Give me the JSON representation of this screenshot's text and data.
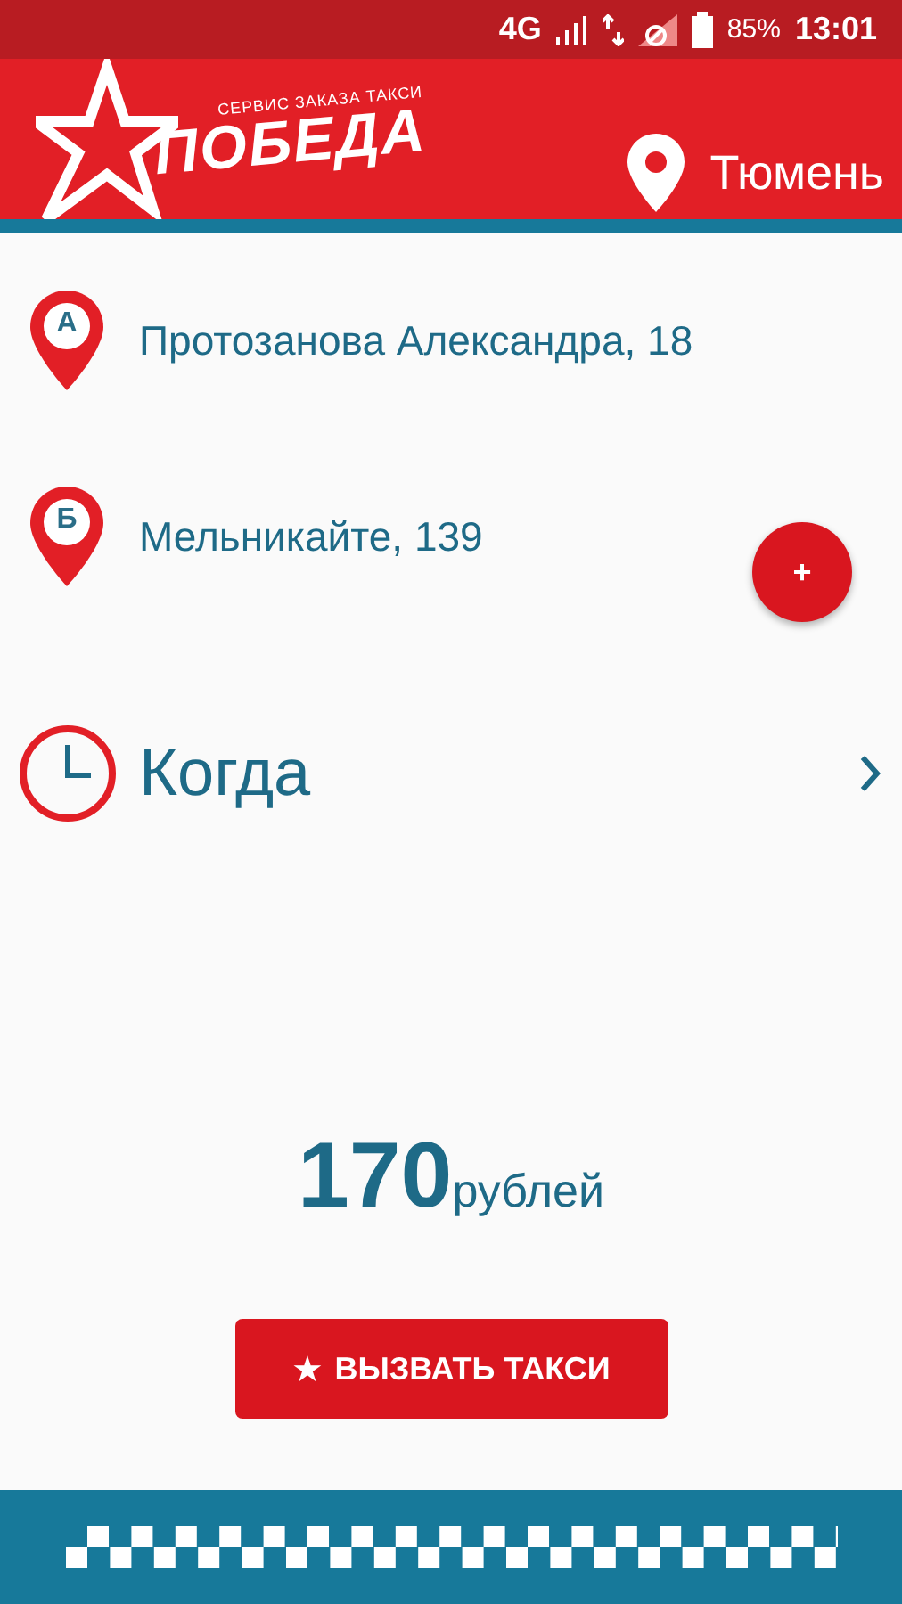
{
  "status_bar": {
    "network": "4G",
    "battery": "85%",
    "time": "13:01"
  },
  "header": {
    "tagline": "СЕРВИС ЗАКАЗА ТАКСИ",
    "brand": "ПОБЕДА",
    "city": "Тюмень"
  },
  "addresses": [
    {
      "marker": "А",
      "text": "Протозанова Александра, 18"
    },
    {
      "marker": "Б",
      "text": "Мельникайте, 139"
    }
  ],
  "add_button": "+",
  "when": "Когда",
  "price": {
    "amount": "170",
    "currency": "рублей"
  },
  "order_button": {
    "icon": "★",
    "label": "ВЫЗВАТЬ ТАКСИ"
  }
}
